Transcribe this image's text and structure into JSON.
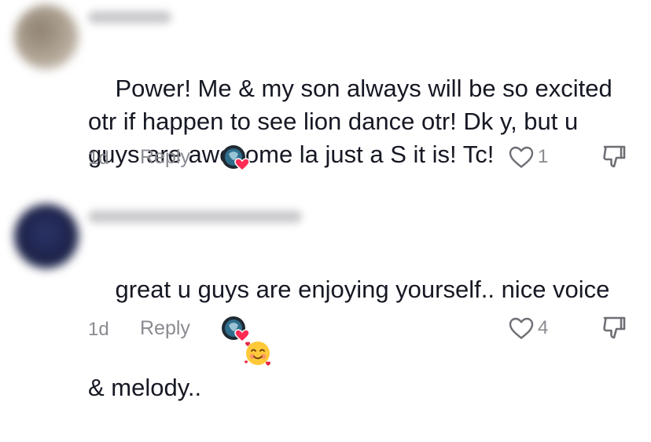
{
  "comments": [
    {
      "text": "Power! Me & my son always will be so excited otr if happen to see lion dance otr! Dk y, but u guys are awesome la just a S it is! Tc!",
      "emoji": "",
      "time": "1d",
      "reply_label": "Reply",
      "likes": "1",
      "avatar_color": "#a39686"
    },
    {
      "text": "great u guys are enjoying yourself.. nice voice & melody..",
      "emoji": "🥰",
      "time": "1d",
      "reply_label": "Reply",
      "likes": "4",
      "avatar_color": "#232a4f"
    }
  ],
  "icons": {
    "like": "heart-outline-icon",
    "dislike": "thumbs-down-icon",
    "creator_liked_badge": "red-heart-badge-icon"
  },
  "colors": {
    "text": "#161823",
    "muted": "#8a8b91",
    "heart_badge": "#fe2c55"
  }
}
